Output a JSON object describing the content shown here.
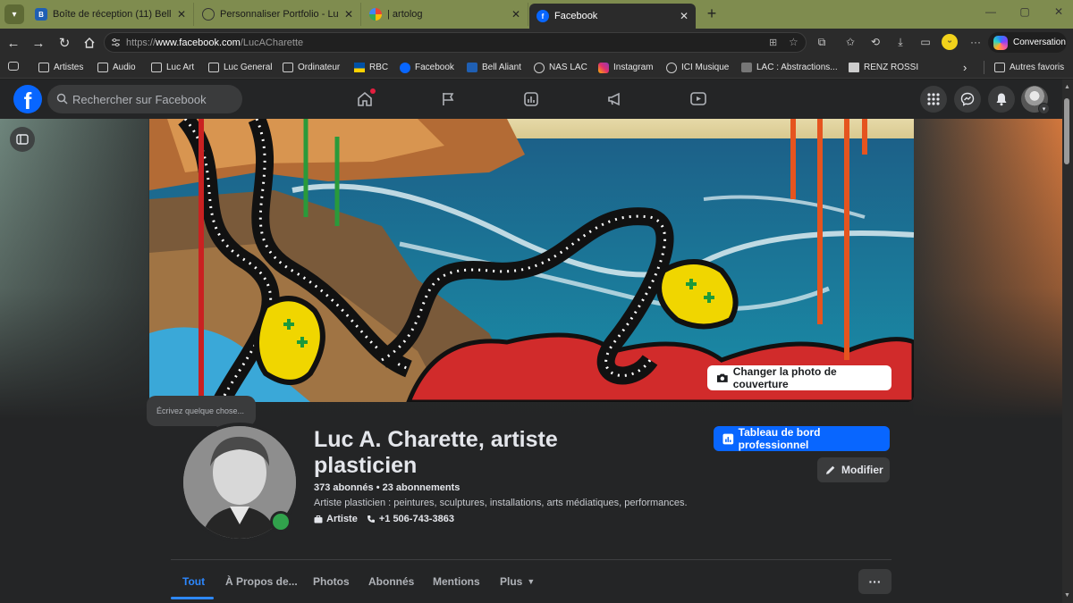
{
  "browser": {
    "tabs": [
      {
        "title": "Boîte de réception (11) Bell",
        "favicon": "bell-icon",
        "active": false
      },
      {
        "title": "Personnaliser Portfolio - Luc A Cha",
        "favicon": "globe-icon",
        "active": false
      },
      {
        "title": "| artolog",
        "favicon": "google-icon",
        "active": false
      },
      {
        "title": "Facebook",
        "favicon": "facebook-icon",
        "active": true
      }
    ],
    "url_prefix": "https://",
    "url_domain": "www.facebook.com",
    "url_path": "/LucACharette",
    "conversation_label": "Conversation",
    "bookmarks": [
      {
        "label": "Artistes",
        "icon": "folder-icon"
      },
      {
        "label": "Audio",
        "icon": "folder-icon"
      },
      {
        "label": "Luc Art",
        "icon": "folder-icon"
      },
      {
        "label": "Luc General",
        "icon": "folder-icon"
      },
      {
        "label": "Ordinateur",
        "icon": "folder-icon"
      },
      {
        "label": "RBC",
        "icon": "rbc-icon"
      },
      {
        "label": "Facebook",
        "icon": "facebook-icon"
      },
      {
        "label": "Bell Aliant",
        "icon": "bell-icon"
      },
      {
        "label": "NAS LAC",
        "icon": "globe-icon"
      },
      {
        "label": "Instagram",
        "icon": "instagram-icon"
      },
      {
        "label": "ICI Musique",
        "icon": "globe-icon"
      },
      {
        "label": "LAC : Abstractions...",
        "icon": "page-icon"
      },
      {
        "label": "RENZ ROSSI",
        "icon": "renz-icon"
      }
    ],
    "other_bookmarks": "Autres favoris"
  },
  "facebook": {
    "search_placeholder": "Rechercher sur Facebook",
    "cover_button": "Changer la photo de couverture",
    "composer_tooltip": "Écrivez quelque chose...",
    "profile": {
      "name": "Luc A. Charette, artiste plasticien",
      "followers": "373 abonnés",
      "following": "23 abonnements",
      "separator": " • ",
      "bio": "Artiste plasticien : peintures, sculptures, installations, arts médiatiques, performances.",
      "category": "Artiste",
      "phone": "+1 506-743-3863"
    },
    "dashboard_button": "Tableau de bord professionnel",
    "edit_button": "Modifier",
    "profile_tabs": [
      "Tout",
      "À Propos de...",
      "Photos",
      "Abonnés",
      "Mentions",
      "Plus"
    ],
    "more_dots": "···"
  },
  "colors": {
    "fb_blue": "#0866ff",
    "link_blue": "#2d88ff",
    "fb_bg": "#242526",
    "card_bg": "#3a3b3c",
    "online_green": "#31a24c",
    "tabstrip_bg": "#7f8c4f"
  }
}
